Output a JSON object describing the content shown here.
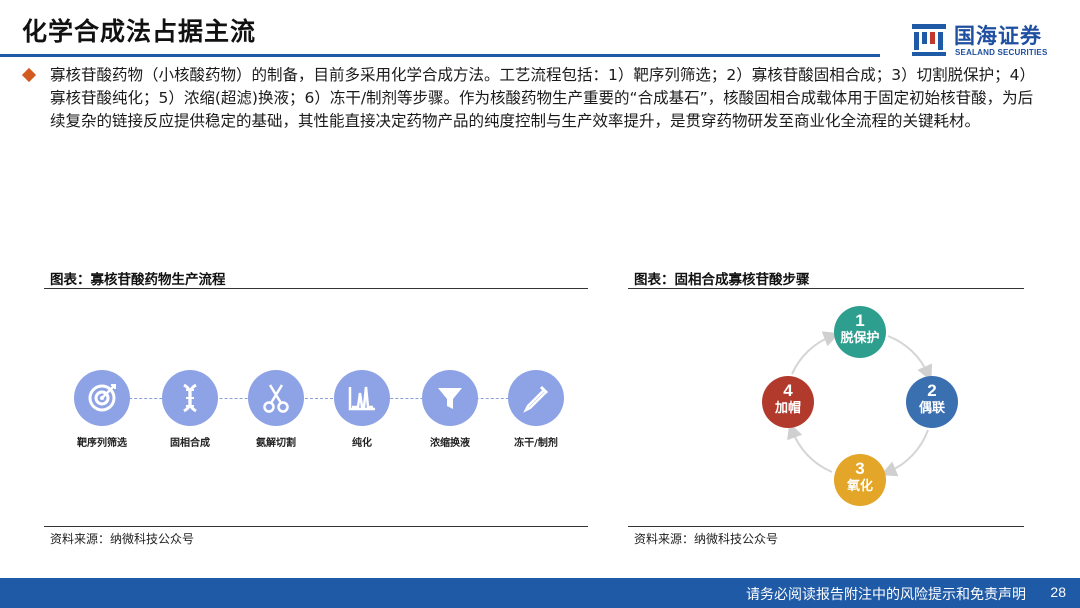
{
  "header": {
    "title": "化学合成法占据主流",
    "logo_cn": "国海证券",
    "logo_en": "SEALAND SECURITIES"
  },
  "intro": {
    "text": "寡核苷酸药物（小核酸药物）的制备，目前多采用化学合成方法。工艺流程包括：1）靶序列筛选；2）寡核苷酸固相合成；3）切割脱保护；4）寡核苷酸纯化；5）浓缩(超滤)换液；6）冻干/制剂等步骤。作为核酸药物生产重要的“合成基石”，核酸固相合成载体用于固定初始核苷酸，为后续复杂的链接反应提供稳定的基础，其性能直接决定药物产品的纯度控制与生产效率提升，是贯穿药物研发至商业化全流程的关键耗材。"
  },
  "left_panel": {
    "title": "图表：寡核苷酸药物生产流程",
    "source": "资料来源：纳微科技公众号",
    "steps": [
      {
        "label": "靶序列筛选",
        "icon": "target-icon"
      },
      {
        "label": "固相合成",
        "icon": "dna-icon"
      },
      {
        "label": "氨解切割",
        "icon": "scissors-icon"
      },
      {
        "label": "纯化",
        "icon": "chromatogram-icon"
      },
      {
        "label": "浓缩换液",
        "icon": "funnel-icon"
      },
      {
        "label": "冻干/制剂",
        "icon": "dropper-icon"
      }
    ]
  },
  "right_panel": {
    "title": "图表：固相合成寡核苷酸步骤",
    "source": "资料来源：纳微科技公众号",
    "nodes": [
      {
        "num": "1",
        "label": "脱保护",
        "color": "#2e9e8e"
      },
      {
        "num": "2",
        "label": "偶联",
        "color": "#3a6fb0"
      },
      {
        "num": "3",
        "label": "氧化",
        "color": "#e3a628"
      },
      {
        "num": "4",
        "label": "加帽",
        "color": "#b23a2c"
      }
    ]
  },
  "footer": {
    "disclaimer": "请务必阅读报告附注中的风险提示和免责声明",
    "page": "28"
  },
  "colors": {
    "brand": "#1f5aa6",
    "bullet": "#d35a1e",
    "step_circle": "#8ea3e6"
  }
}
